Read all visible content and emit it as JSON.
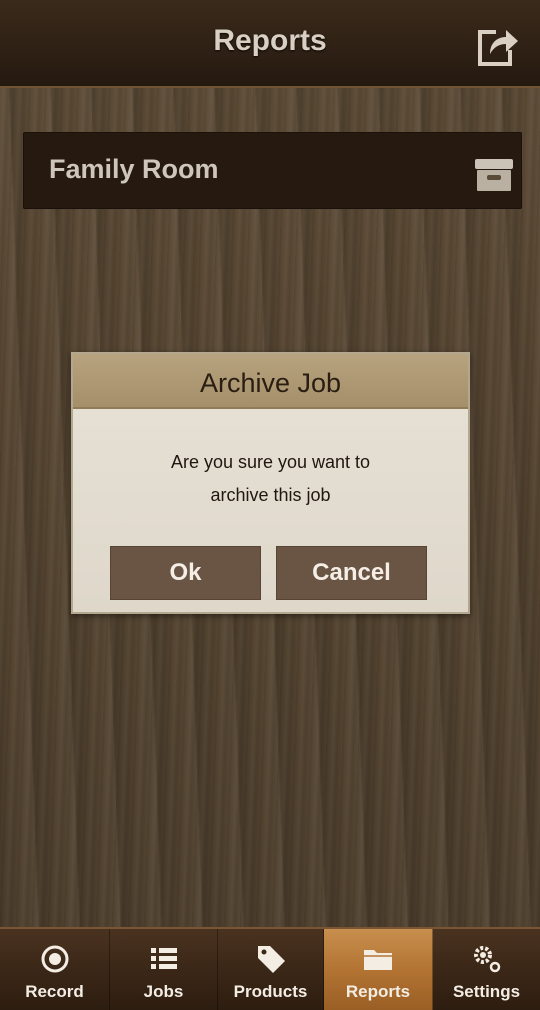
{
  "header": {
    "title": "Reports",
    "export_icon": "share-export-icon"
  },
  "jobs": [
    {
      "name": "Family Room",
      "action_icon": "archive-box-icon"
    }
  ],
  "dialog": {
    "title": "Archive Job",
    "message_line1": "Are you sure you want to",
    "message_line2": "archive this job",
    "ok_label": "Ok",
    "cancel_label": "Cancel"
  },
  "tabbar": {
    "active": "Reports",
    "tabs": [
      {
        "label": "Record",
        "icon": "record-icon"
      },
      {
        "label": "Jobs",
        "icon": "list-icon"
      },
      {
        "label": "Products",
        "icon": "tag-icon"
      },
      {
        "label": "Reports",
        "icon": "folder-icon"
      },
      {
        "label": "Settings",
        "icon": "gears-icon"
      }
    ]
  },
  "colors": {
    "active_tab": "#b37433",
    "dialog_header": "#a48f69",
    "button": "#6a5443"
  }
}
